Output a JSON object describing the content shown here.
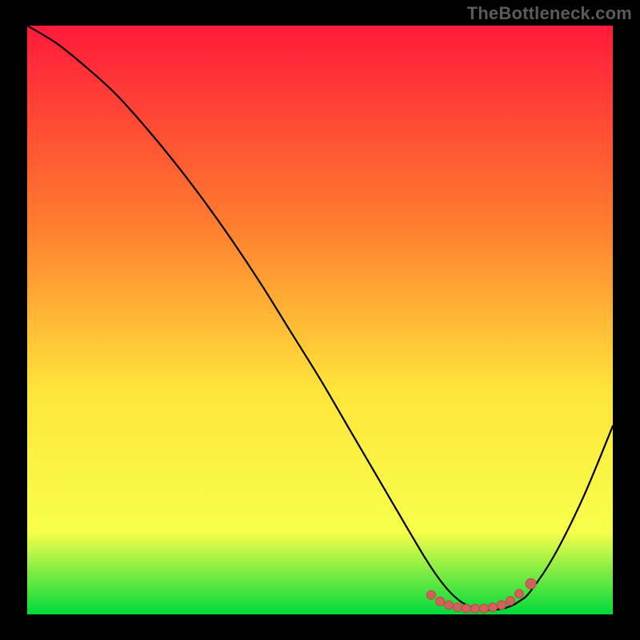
{
  "watermark": "TheBottleneck.com",
  "colors": {
    "frame": "#000000",
    "watermark_text": "#5b5b5b",
    "gradient_top": "#ff1a3a",
    "gradient_mid1": "#ff7a2f",
    "gradient_mid2": "#ffe53b",
    "gradient_mid3": "#f7ff4a",
    "gradient_bottom": "#00d93c",
    "curve": "#000000",
    "marker_fill": "#d2605b",
    "marker_stroke": "#b94e49"
  },
  "chart_data": {
    "type": "line",
    "title": "",
    "xlabel": "",
    "ylabel": "",
    "xlim": [
      0,
      100
    ],
    "ylim": [
      0,
      100
    ],
    "grid": false,
    "legend": false,
    "series": [
      {
        "name": "bottleneck-curve",
        "x": [
          0,
          5,
          10,
          15,
          20,
          25,
          30,
          35,
          40,
          45,
          50,
          55,
          60,
          65,
          68,
          70,
          72,
          74,
          76,
          78,
          80,
          82,
          84,
          86,
          90,
          95,
          100
        ],
        "y": [
          100,
          97,
          93,
          88.5,
          83,
          77,
          70.5,
          63.5,
          56,
          48,
          40,
          31.5,
          23,
          14.5,
          9.5,
          6.5,
          4,
          2.2,
          1.2,
          0.8,
          0.8,
          1.2,
          2.2,
          4,
          10,
          20,
          32
        ]
      }
    ],
    "markers": [
      {
        "name": "optimal-band",
        "x": [
          69,
          70.5,
          72,
          73.5,
          75,
          76.5,
          78,
          79.5,
          81,
          82.5,
          84
        ],
        "y": [
          3.3,
          2.2,
          1.6,
          1.2,
          1.0,
          1.0,
          1.0,
          1.2,
          1.6,
          2.3,
          3.5
        ]
      },
      {
        "name": "highlight-point",
        "x": [
          86
        ],
        "y": [
          5.2
        ]
      }
    ]
  }
}
